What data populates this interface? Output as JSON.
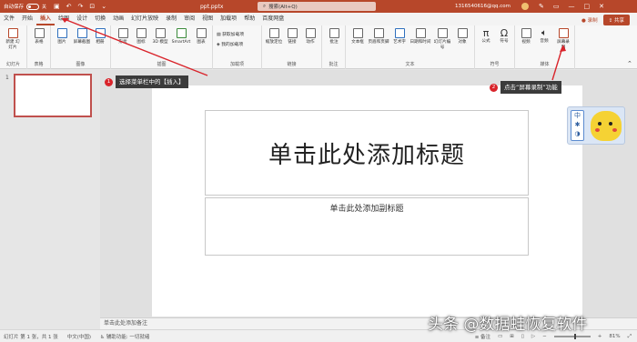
{
  "titlebar": {
    "autosave_label": "自动保存",
    "autosave_state": "关",
    "filename": "ppt.pptx",
    "search_placeholder": "搜索(Alt+Q)",
    "user": "1316540616@qq.com"
  },
  "menubar": {
    "items": [
      "文件",
      "开始",
      "插入",
      "绘图",
      "设计",
      "切换",
      "动画",
      "幻灯片放映",
      "录制",
      "审阅",
      "视图",
      "加载项",
      "帮助",
      "百度网盘"
    ],
    "active_index": 2,
    "record_label": "录制",
    "share_label": "共享"
  },
  "ribbon": {
    "groups": [
      {
        "label": "幻灯片",
        "buttons": [
          "新建\n幻灯片"
        ]
      },
      {
        "label": "表格",
        "buttons": [
          "表格"
        ]
      },
      {
        "label": "图像",
        "buttons": [
          "图片",
          "屏幕截图",
          "相册"
        ]
      },
      {
        "label": "插图",
        "buttons": [
          "形状",
          "图标",
          "3D 模型",
          "SmartArt",
          "图表"
        ]
      },
      {
        "label": "加载项",
        "buttons": [
          "获取加载项",
          "我的加载项"
        ]
      },
      {
        "label": "链接",
        "buttons": [
          "缩放定位",
          "链接",
          "动作"
        ]
      },
      {
        "label": "批注",
        "buttons": [
          "批注"
        ]
      },
      {
        "label": "文本",
        "buttons": [
          "文本框",
          "页眉和页脚",
          "艺术字",
          "日期和时间",
          "幻灯片编号",
          "对象"
        ]
      },
      {
        "label": "符号",
        "buttons": [
          "公式",
          "符号"
        ]
      },
      {
        "label": "媒体",
        "buttons": [
          "视频",
          "音频",
          "屏幕录制"
        ]
      }
    ]
  },
  "slides": {
    "current_number": "1"
  },
  "slide": {
    "title_placeholder": "单击此处添加标题",
    "subtitle_placeholder": "单击此处添加副标题"
  },
  "callouts": {
    "step1_number": "1",
    "step1_text": "选择菜单栏中的【插入】",
    "step2_number": "2",
    "step2_text": "点击“屏幕录制”功能"
  },
  "mascot": {
    "lang_label": "中"
  },
  "notes": {
    "placeholder": "单击此处添加备注"
  },
  "statusbar": {
    "slide_info": "幻灯片 第 1 张，共 1 张",
    "language": "中文(中国)",
    "accessibility": "辅助功能: 一切就绪",
    "notes_label": "备注",
    "zoom": "81%"
  },
  "watermark": {
    "text": "头条 @数据蛙恢复软件"
  },
  "colors": {
    "accent": "#b7472a",
    "callout_bg": "#3b3b3b",
    "badge": "#d9242b"
  }
}
